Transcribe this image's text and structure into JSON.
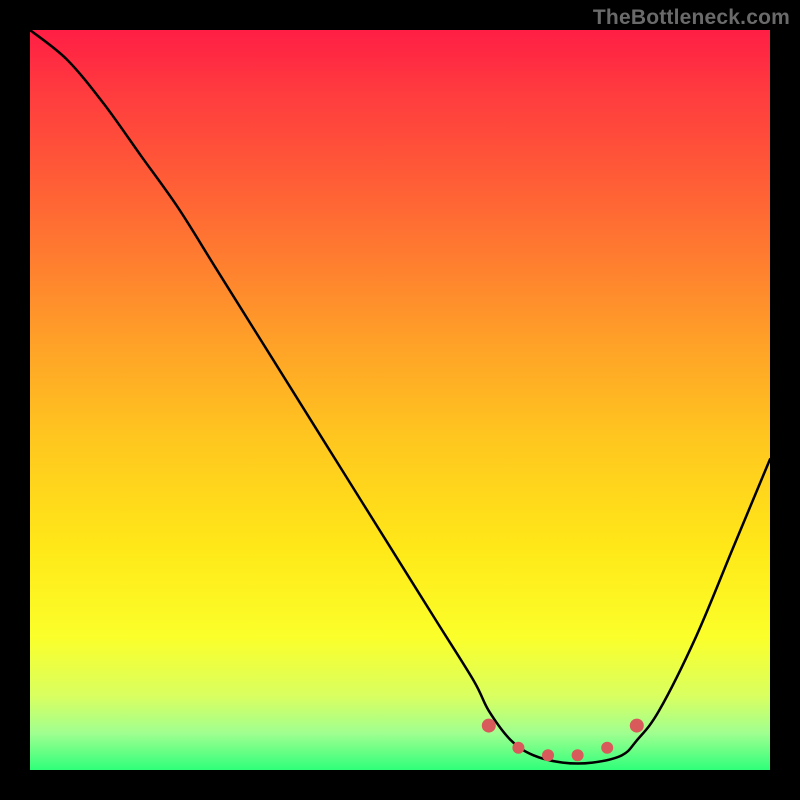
{
  "watermark": "TheBottleneck.com",
  "chart_data": {
    "type": "line",
    "title": "",
    "xlabel": "",
    "ylabel": "",
    "xlim": [
      0,
      100
    ],
    "ylim": [
      0,
      100
    ],
    "series": [
      {
        "name": "curve",
        "x": [
          0,
          5,
          10,
          15,
          20,
          25,
          30,
          35,
          40,
          45,
          50,
          55,
          60,
          62,
          65,
          68,
          72,
          76,
          80,
          82,
          85,
          90,
          95,
          100
        ],
        "values": [
          100,
          96,
          90,
          83,
          76,
          68,
          60,
          52,
          44,
          36,
          28,
          20,
          12,
          8,
          4,
          2,
          1,
          1,
          2,
          4,
          8,
          18,
          30,
          42
        ]
      }
    ],
    "markers": {
      "name": "trough-markers",
      "color": "#d85a5a",
      "points": [
        {
          "x": 62,
          "y": 6
        },
        {
          "x": 66,
          "y": 3
        },
        {
          "x": 70,
          "y": 2
        },
        {
          "x": 74,
          "y": 2
        },
        {
          "x": 78,
          "y": 3
        },
        {
          "x": 82,
          "y": 6
        }
      ]
    },
    "gradient_stops": [
      {
        "pos": 0,
        "color": "#ff1e45"
      },
      {
        "pos": 8,
        "color": "#ff3a3f"
      },
      {
        "pos": 18,
        "color": "#ff5638"
      },
      {
        "pos": 30,
        "color": "#ff7a30"
      },
      {
        "pos": 42,
        "color": "#ffa028"
      },
      {
        "pos": 55,
        "color": "#ffc61f"
      },
      {
        "pos": 70,
        "color": "#ffe818"
      },
      {
        "pos": 82,
        "color": "#fbff2a"
      },
      {
        "pos": 90,
        "color": "#d9ff60"
      },
      {
        "pos": 95,
        "color": "#a0ff90"
      },
      {
        "pos": 100,
        "color": "#2fff7a"
      }
    ]
  }
}
